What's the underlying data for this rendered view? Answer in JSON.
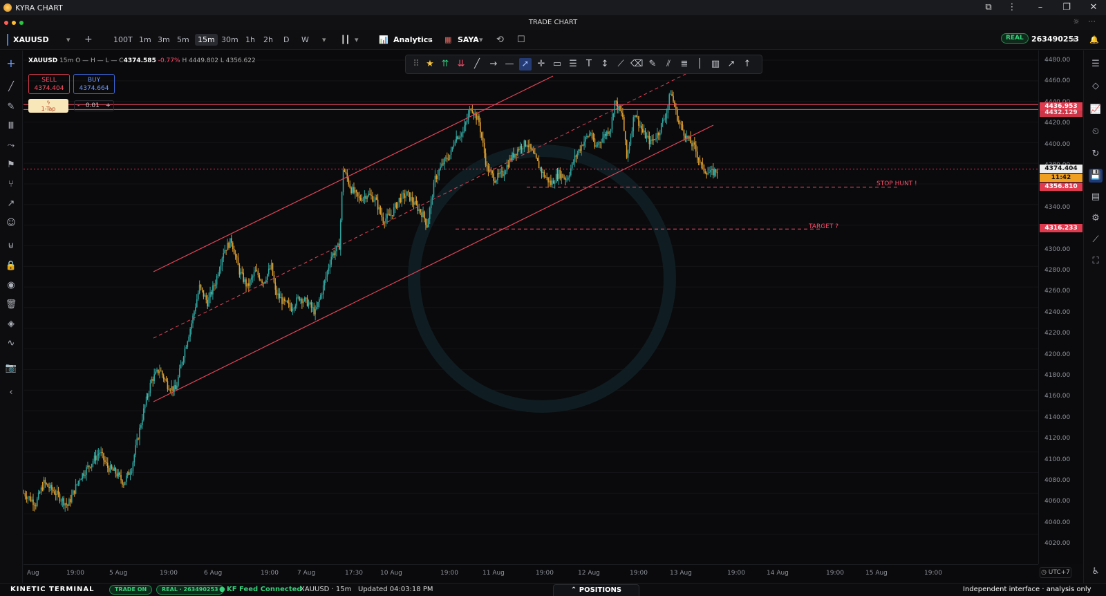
{
  "window": {
    "app_title": "KYRA CHART",
    "tab_title": "TRADE CHART"
  },
  "toolbar": {
    "symbol": "XAUUSD",
    "add_label": "+",
    "timeframes": [
      "100T",
      "1m",
      "3m",
      "5m",
      "15m",
      "30m",
      "1h",
      "2h",
      "D",
      "W"
    ],
    "active_timeframe": "15m",
    "analytics_label": "Analytics",
    "template_label": "SAYA",
    "account_mode": "REAL",
    "account_id": "263490253"
  },
  "infoline": {
    "symbol": "XAUUSD",
    "timeframe": "15m",
    "o": "O —",
    "h": "H —",
    "l": "L —",
    "c_label": "C",
    "close": "4374.585",
    "change": "-0.77%",
    "high": "H 4449.802",
    "low": "L 4356.622"
  },
  "trade_panel": {
    "sell_label": "SELL",
    "sell_price": "4374.404",
    "buy_label": "BUY",
    "buy_price": "4374.664",
    "tap_label": "1-Tap",
    "lot_minus": "-",
    "lot_value": "0.01",
    "lot_plus": "+"
  },
  "price_axis": {
    "labels": [
      "4480.00",
      "4460.00",
      "4440.00",
      "4420.00",
      "4400.00",
      "4380.00",
      "4360.00",
      "4340.00",
      "4320.00",
      "4300.00",
      "4280.00",
      "4260.00",
      "4240.00",
      "4220.00",
      "4200.00",
      "4180.00",
      "4160.00",
      "4140.00",
      "4120.00",
      "4100.00",
      "4080.00",
      "4060.00",
      "4040.00",
      "4020.00"
    ],
    "current_price": "4374.404",
    "countdown": "11:42",
    "levels": [
      "4436.953",
      "4432.129",
      "4356.810",
      "4316.233"
    ]
  },
  "time_axis": {
    "labels": [
      "Aug",
      "19:00",
      "5 Aug",
      "19:00",
      "6 Aug",
      "19:00",
      "7 Aug",
      "17:30",
      "10 Aug",
      "19:00",
      "11 Aug",
      "19:00",
      "12 Aug",
      "19:00",
      "13 Aug",
      "19:00",
      "14 Aug",
      "19:00",
      "15 Aug",
      "19:00"
    ],
    "timezone": "UTC+7"
  },
  "annotations": {
    "stop_hunt": "STOP HUNT !",
    "target": "TARGET ?"
  },
  "statusbar": {
    "brand": "KINETIC TERMINAL",
    "trade_state": "TRADE ON",
    "account": "REAL · 263490253",
    "feed": "KF Feed Connected",
    "symbol_tf": "XAUUSD · 15m",
    "updated": "Updated 04:03:18 PM",
    "positions": "POSITIONS",
    "disclaimer": "Independent interface · analysis only"
  },
  "colors": {
    "bull": "#2fa6a0",
    "bear": "#e0a030",
    "level": "#ff4d6a",
    "accent": "#3b7bff"
  },
  "chart_data": {
    "type": "candlestick",
    "symbol": "XAUUSD",
    "timeframe": "15m",
    "ylim": [
      4010,
      4490
    ],
    "x_ticks": [
      "Aug",
      "19:00",
      "5 Aug",
      "19:00",
      "6 Aug",
      "19:00",
      "7 Aug",
      "17:30",
      "10 Aug",
      "19:00",
      "11 Aug",
      "19:00",
      "12 Aug",
      "19:00",
      "13 Aug",
      "19:00",
      "14 Aug",
      "19:00",
      "15 Aug",
      "19:00"
    ],
    "price_path": [
      [
        0,
        4060
      ],
      [
        3,
        4050
      ],
      [
        5,
        4070
      ],
      [
        8,
        4060
      ],
      [
        11,
        4048
      ],
      [
        14,
        4075
      ],
      [
        17,
        4090
      ],
      [
        19,
        4100
      ],
      [
        21,
        4085
      ],
      [
        23,
        4080
      ],
      [
        25,
        4070
      ],
      [
        27,
        4085
      ],
      [
        30,
        4140
      ],
      [
        32,
        4170
      ],
      [
        34,
        4180
      ],
      [
        36,
        4165
      ],
      [
        38,
        4160
      ],
      [
        40,
        4195
      ],
      [
        42,
        4225
      ],
      [
        44,
        4260
      ],
      [
        46,
        4245
      ],
      [
        48,
        4265
      ],
      [
        50,
        4295
      ],
      [
        52,
        4305
      ],
      [
        54,
        4275
      ],
      [
        56,
        4260
      ],
      [
        58,
        4275
      ],
      [
        60,
        4265
      ],
      [
        62,
        4280
      ],
      [
        63,
        4255
      ],
      [
        65,
        4245
      ],
      [
        67,
        4240
      ],
      [
        69,
        4250
      ],
      [
        71,
        4245
      ],
      [
        73,
        4235
      ],
      [
        75,
        4260
      ],
      [
        77,
        4290
      ],
      [
        79,
        4300
      ],
      [
        80,
        4375
      ],
      [
        82,
        4355
      ],
      [
        84,
        4345
      ],
      [
        86,
        4350
      ],
      [
        88,
        4345
      ],
      [
        90,
        4325
      ],
      [
        92,
        4330
      ],
      [
        94,
        4345
      ],
      [
        96,
        4350
      ],
      [
        98,
        4340
      ],
      [
        100,
        4330
      ],
      [
        101,
        4320
      ],
      [
        103,
        4365
      ],
      [
        105,
        4380
      ],
      [
        107,
        4390
      ],
      [
        108,
        4405
      ],
      [
        110,
        4410
      ],
      [
        112,
        4435
      ],
      [
        114,
        4420
      ],
      [
        116,
        4375
      ],
      [
        118,
        4365
      ],
      [
        120,
        4370
      ],
      [
        122,
        4385
      ],
      [
        124,
        4395
      ],
      [
        126,
        4400
      ],
      [
        128,
        4385
      ],
      [
        130,
        4370
      ],
      [
        132,
        4360
      ],
      [
        134,
        4370
      ],
      [
        136,
        4365
      ],
      [
        138,
        4385
      ],
      [
        140,
        4400
      ],
      [
        142,
        4410
      ],
      [
        143,
        4395
      ],
      [
        145,
        4405
      ],
      [
        147,
        4415
      ],
      [
        148,
        4440
      ],
      [
        150,
        4425
      ],
      [
        151,
        4385
      ],
      [
        153,
        4430
      ],
      [
        155,
        4410
      ],
      [
        157,
        4400
      ],
      [
        159,
        4410
      ],
      [
        161,
        4430
      ],
      [
        162,
        4450
      ],
      [
        164,
        4420
      ],
      [
        166,
        4405
      ],
      [
        168,
        4395
      ],
      [
        170,
        4375
      ],
      [
        172,
        4370
      ],
      [
        174,
        4374
      ]
    ],
    "levels": [
      {
        "label": "4436.953",
        "price": 4436.953,
        "style": "solid"
      },
      {
        "label": "4432.129",
        "price": 4432.129,
        "style": "solid"
      },
      {
        "label": "4374.404",
        "price": 4374.404,
        "style": "dotted"
      },
      {
        "label": "4356.810",
        "price": 4356.81,
        "style": "dashed",
        "annotation": "STOP HUNT !"
      },
      {
        "label": "4316.233",
        "price": 4316.233,
        "style": "dashed",
        "annotation": "TARGET ?"
      }
    ]
  }
}
